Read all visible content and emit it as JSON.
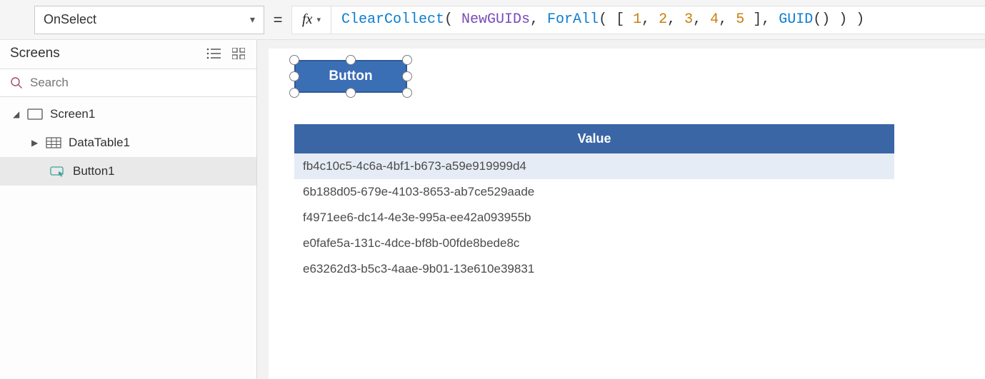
{
  "formula_bar": {
    "property": "OnSelect",
    "equals": "=",
    "fx_label": "fx",
    "tokens": [
      {
        "t": "fn",
        "v": "ClearCollect"
      },
      {
        "t": "punc",
        "v": "( "
      },
      {
        "t": "var",
        "v": "NewGUIDs"
      },
      {
        "t": "punc",
        "v": ", "
      },
      {
        "t": "fn",
        "v": "ForAll"
      },
      {
        "t": "punc",
        "v": "( [ "
      },
      {
        "t": "num",
        "v": "1"
      },
      {
        "t": "punc",
        "v": ", "
      },
      {
        "t": "num",
        "v": "2"
      },
      {
        "t": "punc",
        "v": ", "
      },
      {
        "t": "num",
        "v": "3"
      },
      {
        "t": "punc",
        "v": ", "
      },
      {
        "t": "num",
        "v": "4"
      },
      {
        "t": "punc",
        "v": ", "
      },
      {
        "t": "num",
        "v": "5"
      },
      {
        "t": "punc",
        "v": " ], "
      },
      {
        "t": "fn",
        "v": "GUID"
      },
      {
        "t": "punc",
        "v": "() ) )"
      }
    ]
  },
  "screens_panel": {
    "title": "Screens",
    "search_placeholder": "Search",
    "tree": {
      "screen1": "Screen1",
      "datatable1": "DataTable1",
      "button1": "Button1"
    }
  },
  "canvas": {
    "button_label": "Button",
    "datatable": {
      "header": "Value",
      "rows": [
        "fb4c10c5-4c6a-4bf1-b673-a59e919999d4",
        "6b188d05-679e-4103-8653-ab7ce529aade",
        "f4971ee6-dc14-4e3e-995a-ee42a093955b",
        "e0fafe5a-131c-4dce-bf8b-00fde8bede8c",
        "e63262d3-b5c3-4aae-9b01-13e610e39831"
      ]
    }
  }
}
